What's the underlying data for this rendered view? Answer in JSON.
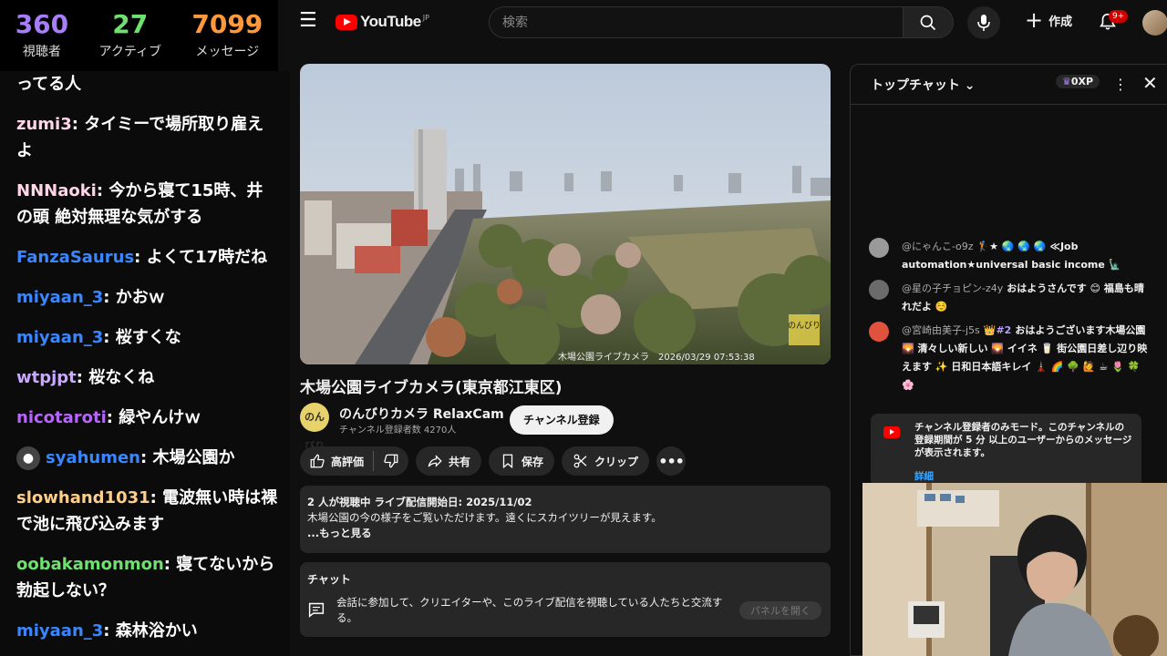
{
  "stream_stats": {
    "viewers": {
      "value": "360",
      "label": "視聴者",
      "color": "#a77df9"
    },
    "active": {
      "value": "27",
      "label": "アクティブ",
      "color": "#6ee16e"
    },
    "messages": {
      "value": "7099",
      "label": "メッセージ",
      "color": "#ff9a3c"
    }
  },
  "overlay_chat": [
    {
      "user": "",
      "text": "ってる人",
      "color": "#ffffff"
    },
    {
      "user": "zumi3",
      "text": ": タイミーで場所取り雇えよ",
      "color": "#ffd6e7"
    },
    {
      "user": "NNNaoki",
      "text": ": 今から寝て15時、井の頭 絶対無理な気がする",
      "color": "#ffd6e7"
    },
    {
      "user": "FanzaSaurus",
      "text": ": よくて17時だね",
      "color": "#3a86ff"
    },
    {
      "user": "miyaan_3",
      "text": ": かおｗ",
      "color": "#3a86ff"
    },
    {
      "user": "miyaan_3",
      "text": ": 桜すくな",
      "color": "#3a86ff"
    },
    {
      "user": "wtpjpt",
      "text": ": 桜なくね",
      "color": "#c9a8ff"
    },
    {
      "user": "nicotaroti",
      "text": ": 緑やんけｗ",
      "color": "#b565f7"
    },
    {
      "user": "syahumen",
      "text": ": 木場公園か",
      "color": "#3a86ff",
      "avatar": true
    },
    {
      "user": "slowhand1031",
      "text": ": 電波無い時は裸で池に飛び込みます",
      "color": "#ffcf8a"
    },
    {
      "user": "oobakamonmon",
      "text": ": 寝てないから勃起しない？",
      "color": "#6ee16e"
    },
    {
      "user": "miyaan_3",
      "text": ": 森林浴かい",
      "color": "#3a86ff"
    }
  ],
  "header": {
    "logo_text": "YouTube",
    "logo_region": "JP",
    "search_placeholder": "検索",
    "create_label": "作成",
    "notification_badge": "9+"
  },
  "video": {
    "title": "木場公園ライブカメラ(東京都江東区)",
    "overlay_caption": "木場公園ライブカメラ　2026/03/29 07:53:38",
    "watermark": "のんびり"
  },
  "channel": {
    "name": "のんびりカメラ RelaxCam",
    "subscribers": "チャンネル登録者数 4270人",
    "avatar_text": "のんびり",
    "subscribe_label": "チャンネル登録"
  },
  "actions": {
    "like": "高評価",
    "share": "共有",
    "save": "保存",
    "clip": "クリップ"
  },
  "description": {
    "meta": "2 人が視聴中  ライブ配信開始日: 2025/11/02",
    "text": "木場公園の今の様子をご覧いただけます。遠くにスカイツリーが見えます。",
    "more": "...もっと見る"
  },
  "chat_box": {
    "heading": "チャット",
    "body": "会話に参加して、クリエイターや、このライブ配信を視聴している人たちと交流する。",
    "open_panel": "パネルを開く"
  },
  "live_chat": {
    "title": "トップチャット",
    "xp": "0XP",
    "messages": [
      {
        "name": "@にゃんこ-o9z",
        "text": "🏌★ 🌏 🌏 🌏 ≪Job automation★universal basic income 🗽",
        "avatar_color": "#9a9a9a",
        "mod": ""
      },
      {
        "name": "@星の子チョピン-z4y",
        "text": "おはようさんです 😊 福島も晴れだよ ☺️",
        "avatar_color": "#6b6b6b",
        "mod": ""
      },
      {
        "name": "@宮崎由美子-j5s",
        "text": "おはようございます木場公園 🌄 清々しい新しい 🌄 イイネ 🥛 街公園日差し辺り映えます ✨ 日和日本語キレイ 🗼 🌈 🌳 🙋 ☕ 🌷 🍀 🌸",
        "avatar_color": "#e0523c",
        "mod": "👑#2"
      }
    ],
    "banner_text": "チャンネル登録者のみモード。このチャンネルの登録期間が 5 分 以上のユーザーからのメッセージが表示されます。",
    "banner_detail": "詳細"
  }
}
